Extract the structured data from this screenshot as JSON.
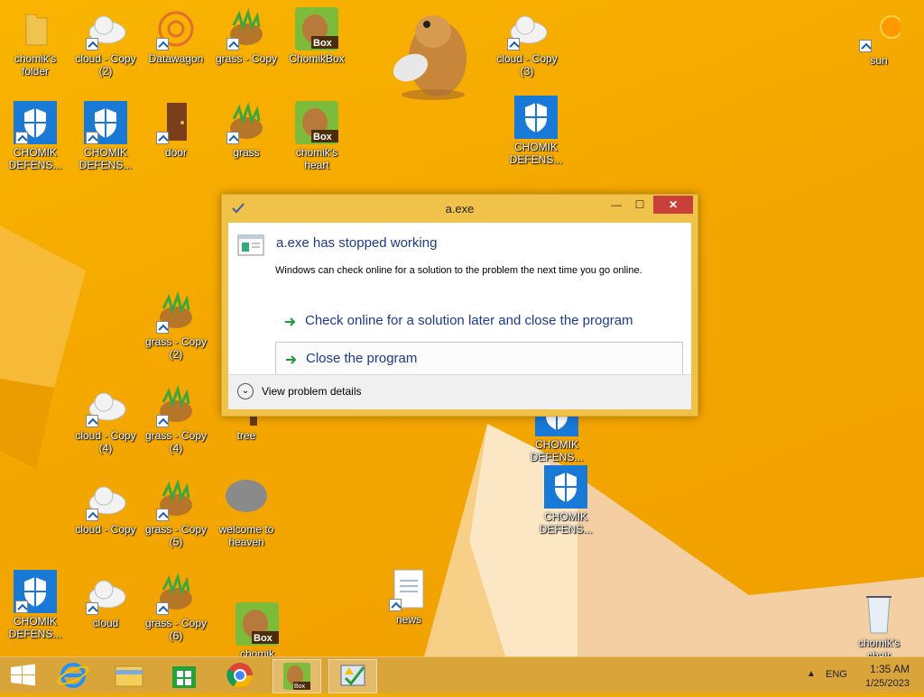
{
  "desktop_icons": [
    {
      "label": "chomik's folder",
      "icon": "folder-icon"
    },
    {
      "label": "cloud - Copy (2)",
      "icon": "cloud-icon"
    },
    {
      "label": "Datawagon",
      "icon": "datawagon-icon"
    },
    {
      "label": "grass - Copy",
      "icon": "grass-icon"
    },
    {
      "label": "ChomikBox",
      "icon": "chomikbox-icon"
    },
    {
      "label": "cloud - Copy (3)",
      "icon": "cloud-icon"
    },
    {
      "label": "sun",
      "icon": "sun-icon"
    },
    {
      "label": "CHOMIK DEFENS...",
      "icon": "shield-icon"
    },
    {
      "label": "CHOMIK DEFENS...",
      "icon": "shield-icon"
    },
    {
      "label": "door",
      "icon": "door-icon"
    },
    {
      "label": "grass",
      "icon": "grass-icon"
    },
    {
      "label": "chomik's heart",
      "icon": "chomikbox-icon"
    },
    {
      "label": "CHOMIK DEFENS...",
      "icon": "shield-icon"
    },
    {
      "label": "grass - Copy (2)",
      "icon": "grass-icon"
    },
    {
      "label": "cloud - Copy (4)",
      "icon": "cloud-icon"
    },
    {
      "label": "grass - Copy (4)",
      "icon": "grass-icon"
    },
    {
      "label": "tree",
      "icon": "tree-icon"
    },
    {
      "label": "CHOMIK DEFENS...",
      "icon": "shield-icon"
    },
    {
      "label": "cloud - Copy",
      "icon": "cloud-icon"
    },
    {
      "label": "grass - Copy (5)",
      "icon": "grass-icon"
    },
    {
      "label": "welcome to heaven",
      "icon": "blob-icon"
    },
    {
      "label": "CHOMIK DEFENS...",
      "icon": "shield-icon"
    },
    {
      "label": "CHOMIK DEFENS...",
      "icon": "shield-icon"
    },
    {
      "label": "cloud",
      "icon": "cloud-icon"
    },
    {
      "label": "grass - Copy (6)",
      "icon": "grass-icon"
    },
    {
      "label": "chomik",
      "icon": "chomikbox-icon"
    },
    {
      "label": "news",
      "icon": "document-icon"
    },
    {
      "label": "chomik's chair",
      "icon": "recycle-bin-icon"
    }
  ],
  "dialog": {
    "title": "a.exe",
    "heading": "a.exe has stopped working",
    "description": "Windows can check online for a solution to the problem the next time you go online.",
    "option1": "Check online for a solution later and close the program",
    "option2": "Close the program",
    "details": "View problem details",
    "minimize": "—",
    "maximize": "☐",
    "close": "✕"
  },
  "taskbar": {
    "items": [
      "start-icon",
      "internet-explorer-icon",
      "file-explorer-icon",
      "store-icon",
      "chrome-icon",
      "chomikbox-icon",
      "error-reporting-icon"
    ],
    "language": "ENG",
    "time": "1:35 AM",
    "date": "1/25/2023"
  },
  "colors": {
    "accent": "#f4a700",
    "dialog_frame": "#f0c24a",
    "close_button": "#c9403a",
    "link_blue": "#1c3a8a"
  }
}
